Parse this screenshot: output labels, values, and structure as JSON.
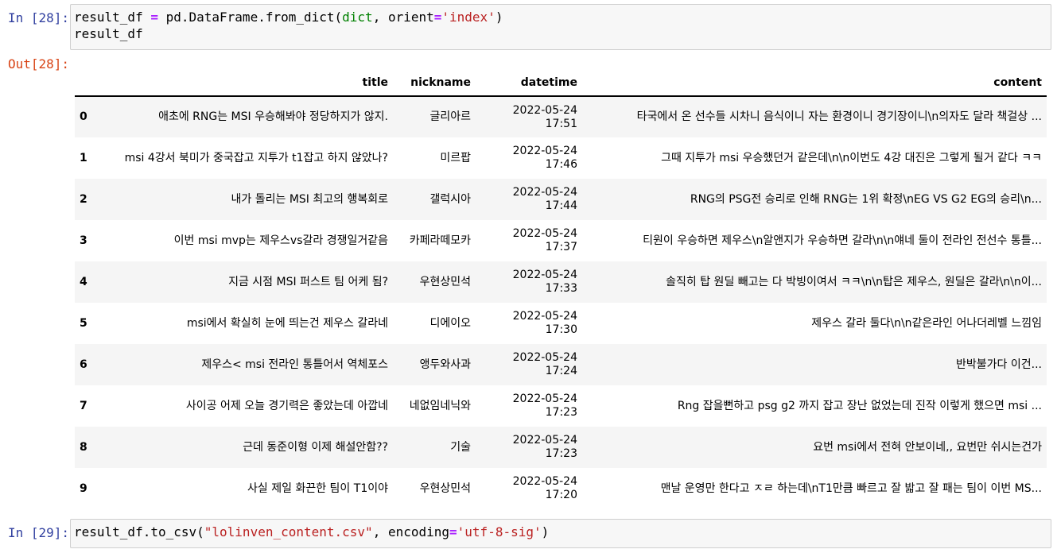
{
  "cells": {
    "in28_prompt": "In [28]:",
    "in28_code": {
      "l1_var": "result_df ",
      "l1_eq": "=",
      "l1_mid": " pd.DataFrame.from_dict(",
      "l1_builtin": "dict",
      "l1_sep": ", orient",
      "l1_eq2": "=",
      "l1_str": "'index'",
      "l1_end": ")",
      "l2": "result_df"
    },
    "out28_prompt": "Out[28]:",
    "in29_prompt": "In [29]:",
    "in29_code": {
      "pre": "result_df.to_csv(",
      "str1": "\"lolinven_content.csv\"",
      "sep": ", encoding",
      "eq": "=",
      "str2": "'utf-8-sig'",
      "end": ")"
    }
  },
  "dataframe": {
    "columns": [
      "",
      "title",
      "nickname",
      "datetime",
      "content"
    ],
    "rows": [
      {
        "index": "0",
        "title": "애초에 RNG는 MSI 우승해봐야 정당하지가 않지.",
        "nickname": "글리아르",
        "datetime": "2022-05-24 17:51",
        "content": "타국에서 온 선수들 시차니 음식이니 자는 환경이니 경기장이니\\n의자도 달라 책걸상 ..."
      },
      {
        "index": "1",
        "title": "msi 4강서 북미가 중국잡고 지투가 t1잡고 하지 않았나?",
        "nickname": "미르팝",
        "datetime": "2022-05-24 17:46",
        "content": "그때 지투가 msi 우승했던거 같은데\\n\\n이번도 4강 대진은 그렇게 될거 같다 ㅋㅋ"
      },
      {
        "index": "2",
        "title": "내가 돌리는 MSI 최고의 행복회로",
        "nickname": "갤럭시아",
        "datetime": "2022-05-24 17:44",
        "content": "RNG의 PSG전 승리로 인해 RNG는 1위 확정\\nEG VS G2 EG의 승리\\n..."
      },
      {
        "index": "3",
        "title": "이번 msi mvp는 제우스vs갈라 경쟁일거같음",
        "nickname": "카페라떼모카",
        "datetime": "2022-05-24 17:37",
        "content": "티원이 우승하면 제우스\\n알앤지가 우승하면 갈라\\n\\n얘네 둘이 전라인 전선수 통틀..."
      },
      {
        "index": "4",
        "title": "지금 시점 MSI 퍼스트 팀 어케 됨?",
        "nickname": "우현상민석",
        "datetime": "2022-05-24 17:33",
        "content": "솔직히 탑 원딜 빼고는 다 박빙이여서 ㅋㅋ\\n\\n탑은 제우스, 원딜은 갈라\\n\\n이..."
      },
      {
        "index": "5",
        "title": "msi에서 확실히 눈에 띄는건 제우스 갈라네",
        "nickname": "디에이오",
        "datetime": "2022-05-24 17:30",
        "content": "제우스 갈라 둘다\\n\\n같은라인 어나더레벨 느낌임"
      },
      {
        "index": "6",
        "title": "제우스< msi 전라인 통틀어서 역체포스",
        "nickname": "앵두와사과",
        "datetime": "2022-05-24 17:24",
        "content": "반박불가다 이건..."
      },
      {
        "index": "7",
        "title": "사이공 어제 오늘 경기력은 좋았는데 아깝네",
        "nickname": "네없임네닉와",
        "datetime": "2022-05-24 17:23",
        "content": "Rng 잡을뻔하고 psg g2 까지 잡고 장난 없었는데 진작 이렇게 했으면 msi ..."
      },
      {
        "index": "8",
        "title": "근데 동준이형 이제 해설안함??",
        "nickname": "기술",
        "datetime": "2022-05-24 17:23",
        "content": "요번 msi에서 전혀 안보이네,, 요번만 쉬시는건가"
      },
      {
        "index": "9",
        "title": "사실 제일 화끈한 팀이 T1이야",
        "nickname": "우현상민석",
        "datetime": "2022-05-24 17:20",
        "content": "맨날 운영만 한다고 ㅈㄹ 하는데\\nT1만큼 빠르고 잘 밟고 잘 패는 팀이 이번 MS..."
      }
    ]
  }
}
